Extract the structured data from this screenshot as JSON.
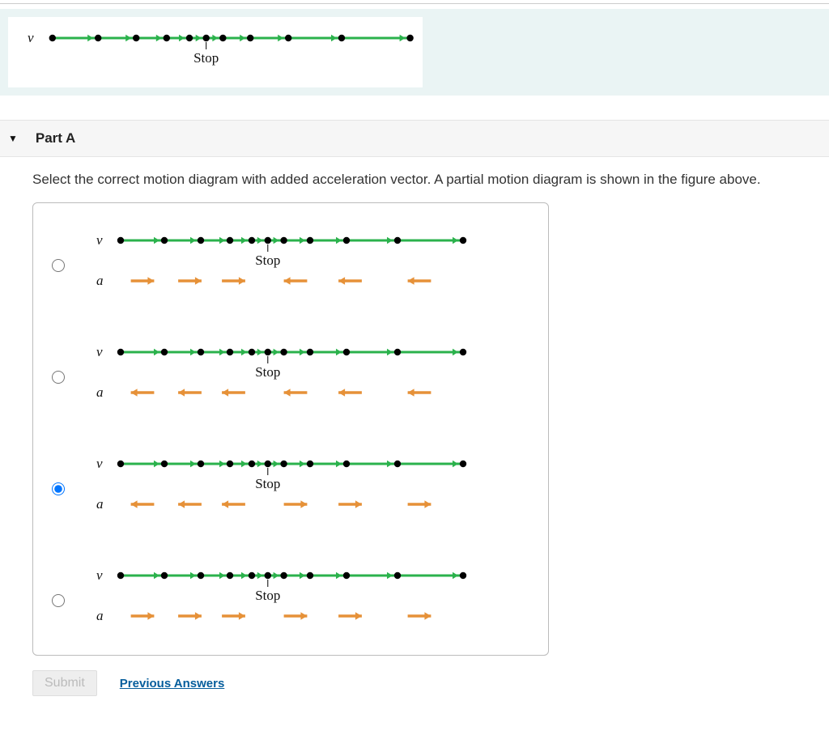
{
  "partLabel": "Part A",
  "question": "Select the correct motion diagram with added acceleration vector. A partial motion diagram is shown in the figure above.",
  "stopLabel": "Stop",
  "vLabel": "v⃗",
  "aLabel": "a⃗",
  "submitLabel": "Submit",
  "prevLabel": "Previous Answers",
  "options": [
    {
      "accelDirs": [
        "r",
        "r",
        "r",
        "l",
        "l",
        "l"
      ],
      "selected": false
    },
    {
      "accelDirs": [
        "l",
        "l",
        "l",
        "l",
        "l",
        "l"
      ],
      "selected": false
    },
    {
      "accelDirs": [
        "l",
        "l",
        "l",
        "r",
        "r",
        "r"
      ],
      "selected": true
    },
    {
      "accelDirs": [
        "r",
        "r",
        "r",
        "r",
        "r",
        "r"
      ],
      "selected": false
    }
  ],
  "velocityDots": [
    20,
    80,
    130,
    170,
    200,
    222,
    244,
    280,
    330,
    400,
    490
  ],
  "stopX": 222,
  "colors": {
    "velocity": "#2bb24c",
    "accel": "#e69138",
    "dot": "#000"
  }
}
